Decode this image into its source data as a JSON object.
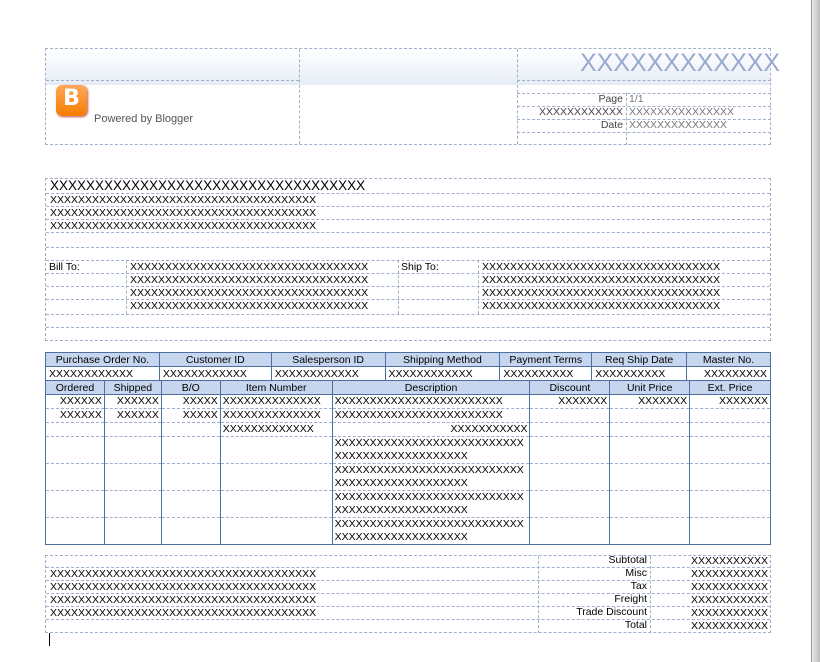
{
  "header": {
    "powered_by": "Powered by Blogger",
    "company_title": "XXXXXXXXXXXX",
    "page_label": "Page",
    "page_value": "1/1",
    "ref_label": "XXXXXXXXXXXX",
    "ref_value": "XXXXXXXXXXXXXXX",
    "date_label": "Date",
    "date_value": "XXXXXXXXXXXXXX"
  },
  "address": {
    "company_name": "XXXXXXXXXXXXXXXXXXXXXXXXXXXXXXXXXXX",
    "lines": [
      "XXXXXXXXXXXXXXXXXXXXXXXXXXXXXXXXXXXXXX",
      "XXXXXXXXXXXXXXXXXXXXXXXXXXXXXXXXXXXXXX",
      "XXXXXXXXXXXXXXXXXXXXXXXXXXXXXXXXXXXXXX"
    ],
    "bill_to_label": "Bill To:",
    "ship_to_label": "Ship To:",
    "bill_to": [
      "XXXXXXXXXXXXXXXXXXXXXXXXXXXXXXXXXX",
      "XXXXXXXXXXXXXXXXXXXXXXXXXXXXXXXXXX",
      "XXXXXXXXXXXXXXXXXXXXXXXXXXXXXXXXXX",
      "XXXXXXXXXXXXXXXXXXXXXXXXXXXXXXXXXX"
    ],
    "ship_to": [
      "XXXXXXXXXXXXXXXXXXXXXXXXXXXXXXXXXX",
      "XXXXXXXXXXXXXXXXXXXXXXXXXXXXXXXXXX",
      "XXXXXXXXXXXXXXXXXXXXXXXXXXXXXXXXXX",
      "XXXXXXXXXXXXXXXXXXXXXXXXXXXXXXXXXX"
    ]
  },
  "order": {
    "headers": [
      "Purchase Order No.",
      "Customer ID",
      "Salesperson ID",
      "Shipping Method",
      "Payment Terms",
      "Req Ship Date",
      "Master No."
    ],
    "values": [
      "XXXXXXXXXXXX",
      "XXXXXXXXXXXX",
      "XXXXXXXXXXXX",
      "XXXXXXXXXXXX",
      "XXXXXXXXXX",
      "XXXXXXXXXX",
      "XXXXXXXXX"
    ]
  },
  "items": {
    "headers": [
      "Ordered",
      "Shipped",
      "B/O",
      "Item Number",
      "Description",
      "Discount",
      "Unit Price",
      "Ext. Price"
    ],
    "rows": [
      {
        "ordered": "XXXXXX",
        "shipped": "XXXXXX",
        "bo": "XXXXX",
        "item": "XXXXXXXXXXXXXX",
        "desc": "XXXXXXXXXXXXXXXXXXXXXXXX",
        "discount": "XXXXXXX",
        "unit": "XXXXXXX",
        "ext": "XXXXXXX"
      },
      {
        "ordered": "XXXXXX",
        "shipped": "XXXXXX",
        "bo": "XXXXX",
        "item": "XXXXXXXXXXXXXX",
        "desc": "XXXXXXXXXXXXXXXXXXXXXXXX",
        "discount": "",
        "unit": "",
        "ext": ""
      },
      {
        "ordered": "",
        "shipped": "",
        "bo": "",
        "item": "XXXXXXXXXXXXX",
        "desc": "XXXXXXXXXXX",
        "discount": "",
        "unit": "",
        "ext": ""
      },
      {
        "ordered": "",
        "shipped": "",
        "bo": "",
        "item": "",
        "desc": "XXXXXXXXXXXXXXXXXXXXXXXXXXXXXXXXXXXXXXXXXXXXXX",
        "discount": "",
        "unit": "",
        "ext": ""
      },
      {
        "ordered": "",
        "shipped": "",
        "bo": "",
        "item": "",
        "desc": "XXXXXXXXXXXXXXXXXXXXXXXXXXXXXXXXXXXXXXXXXXXXXX",
        "discount": "",
        "unit": "",
        "ext": ""
      },
      {
        "ordered": "",
        "shipped": "",
        "bo": "",
        "item": "",
        "desc": "XXXXXXXXXXXXXXXXXXXXXXXXXXXXXXXXXXXXXXXXXXXXXX",
        "discount": "",
        "unit": "",
        "ext": ""
      },
      {
        "ordered": "",
        "shipped": "",
        "bo": "",
        "item": "",
        "desc": "XXXXXXXXXXXXXXXXXXXXXXXXXXXXXXXXXXXXXXXXXXXXXX",
        "discount": "",
        "unit": "",
        "ext": ""
      }
    ]
  },
  "totals": {
    "notes": [
      "XXXXXXXXXXXXXXXXXXXXXXXXXXXXXXXXXXXXXX",
      "XXXXXXXXXXXXXXXXXXXXXXXXXXXXXXXXXXXXXX",
      "XXXXXXXXXXXXXXXXXXXXXXXXXXXXXXXXXXXXXX",
      "XXXXXXXXXXXXXXXXXXXXXXXXXXXXXXXXXXXXXX"
    ],
    "labels": [
      "Subtotal",
      "Misc",
      "Tax",
      "Freight",
      "Trade Discount",
      "Total"
    ],
    "values": [
      "XXXXXXXXXXX",
      "XXXXXXXXXXX",
      "XXXXXXXXXXX",
      "XXXXXXXXXXX",
      "XXXXXXXXXXX",
      "XXXXXXXXXXX"
    ]
  },
  "colors": {
    "header_fill": "#c6d6ee",
    "grid_border": "#4e6fa0",
    "dashed_line": "#9fb1c8",
    "title_text": "#9aa9cf",
    "blogger_orange": "#f57d00"
  }
}
